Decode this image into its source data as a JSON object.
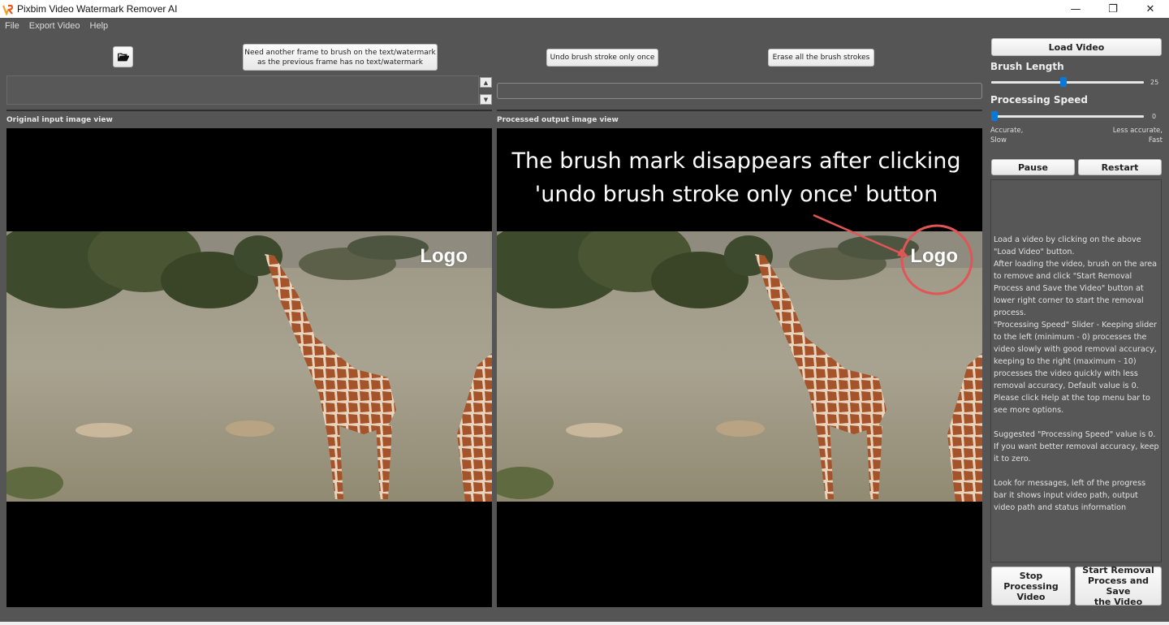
{
  "window": {
    "title": "Pixbim Video Watermark Remover AI",
    "controls": {
      "minimize": "—",
      "maximize": "❐",
      "close": "✕"
    }
  },
  "menu": {
    "items": [
      "File",
      "Export Video",
      "Help"
    ]
  },
  "toolbar": {
    "open_icon": "folder-open-icon",
    "another_frame_line1": "Need another frame to brush on the text/watermark",
    "another_frame_line2": "as the previous frame has no text/watermark",
    "undo_label": "Undo brush stroke only once",
    "erase_label": "Erase all the brush strokes"
  },
  "messages": {
    "log_text": "",
    "scroll_up": "▲",
    "scroll_down": "▼"
  },
  "progress": {
    "value_percent": 0
  },
  "views": {
    "input_label": "Original input image view",
    "output_label": "Processed output image view",
    "input_watermark": "Logo",
    "output_watermark": "Logo",
    "annotation_line1": "The brush mark disappears after clicking",
    "annotation_line2": "'undo brush stroke only once' button",
    "annotation_color": "#e05555"
  },
  "right_panel": {
    "load_video_label": "Load Video",
    "brush_length_label": "Brush Length",
    "brush_length_value": "25",
    "brush_length_fraction": 0.47,
    "processing_speed_label": "Processing Speed",
    "processing_speed_value": "0",
    "processing_speed_min": 0,
    "processing_speed_max": 10,
    "speed_left_hint_1": "Accurate,",
    "speed_left_hint_2": "Slow",
    "speed_right_hint_1": "Less accurate,",
    "speed_right_hint_2": "Fast",
    "pause_label": "Pause",
    "restart_label": "Restart",
    "info_text": "Load a video by clicking on the above \"Load Video\" button.\nAfter loading the video, brush on the area to remove and click \"Start Removal Process and Save the Video\" button at lower right corner to start the removal process.\n\"Processing Speed\" Slider - Keeping slider to the left (minimum - 0) processes the video slowly with good removal accuracy, keeping to the right (maximum - 10) processes the video quickly with less removal accuracy, Default value is 0.\nPlease click Help at the top menu bar to see more options.\n\nSuggested \"Processing Speed\" value is 0.\nIf you want better removal accuracy, keep it to zero.\n\nLook for messages, left of the progress bar it shows input video path, output video path and status information",
    "stop_label_1": "Stop Processing",
    "stop_label_2": "Video",
    "start_label_1": "Start Removal",
    "start_label_2": "Process and Save",
    "start_label_3": "the Video",
    "accent_color": "#0a78d7"
  }
}
